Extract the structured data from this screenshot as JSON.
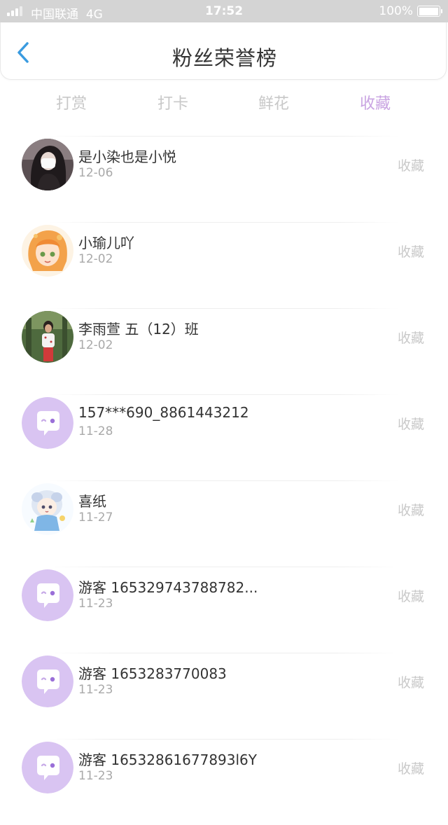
{
  "status_bar": {
    "carrier": "中国联通",
    "network": "4G",
    "time": "17:52",
    "battery_text": "100%",
    "battery_level": 1.0
  },
  "header": {
    "title": "粉丝荣誉榜",
    "back_icon": "chevron-left-icon"
  },
  "tabs": [
    {
      "label": "打赏",
      "active": false
    },
    {
      "label": "打卡",
      "active": false
    },
    {
      "label": "鲜花",
      "active": false
    },
    {
      "label": "收藏",
      "active": true
    }
  ],
  "colors": {
    "accent": "#c9a4e2",
    "back_icon": "#3a9be0",
    "status_bar": "#d4d4d4",
    "default_avatar_bg": "#d9c4f2"
  },
  "list": [
    {
      "name": "是小染也是小悦",
      "date": "12-06",
      "action": "收藏",
      "avatar": "photo-avatar-1"
    },
    {
      "name": "小瑜儿吖",
      "date": "12-02",
      "action": "收藏",
      "avatar": "illustration-avatar-1"
    },
    {
      "name": "李雨萱 五（12）班",
      "date": "12-02",
      "action": "收藏",
      "avatar": "photo-avatar-2"
    },
    {
      "name": "157***690_8861443212",
      "date": "11-28",
      "action": "收藏",
      "avatar": "default-chat-avatar"
    },
    {
      "name": "喜纸",
      "date": "11-27",
      "action": "收藏",
      "avatar": "illustration-avatar-2"
    },
    {
      "name": "游客 165329743788782...",
      "date": "11-23",
      "action": "收藏",
      "avatar": "default-chat-avatar"
    },
    {
      "name": "游客 1653283770083",
      "date": "11-23",
      "action": "收藏",
      "avatar": "default-chat-avatar"
    },
    {
      "name": "游客 16532861677893l6Y",
      "date": "11-23",
      "action": "收藏",
      "avatar": "default-chat-avatar"
    }
  ]
}
